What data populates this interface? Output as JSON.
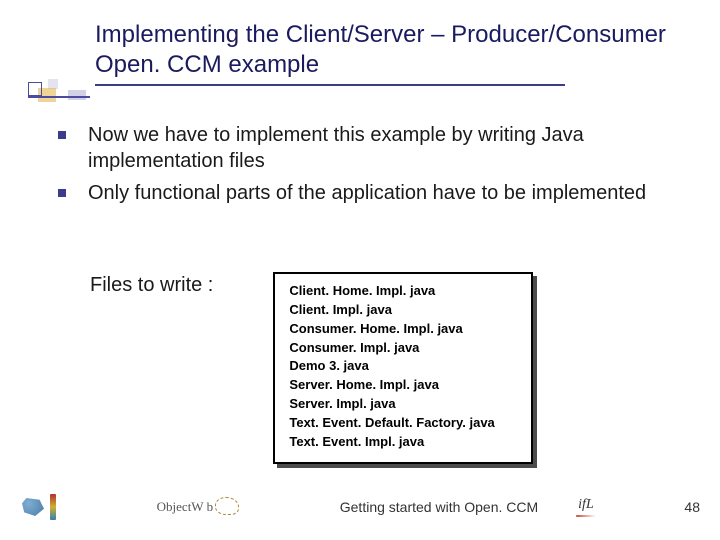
{
  "title": "Implementing the Client/Server – Producer/Consumer Open. CCM example",
  "bullets": [
    "Now we have to implement this example by writing Java implementation files",
    "Only functional parts of the application have to be implemented"
  ],
  "files_label": "Files to write :",
  "files": [
    "Client. Home. Impl. java",
    "Client. Impl. java",
    "Consumer. Home. Impl. java",
    "Consumer. Impl. java",
    "Demo 3. java",
    "Server. Home. Impl. java",
    "Server. Impl. java",
    "Text. Event. Default. Factory. java",
    "Text. Event. Impl. java"
  ],
  "footer": {
    "center_logo_text": "ObjectW b",
    "caption": "Getting started with Open. CCM",
    "ifl_text": "ifL",
    "page_number": "48"
  }
}
